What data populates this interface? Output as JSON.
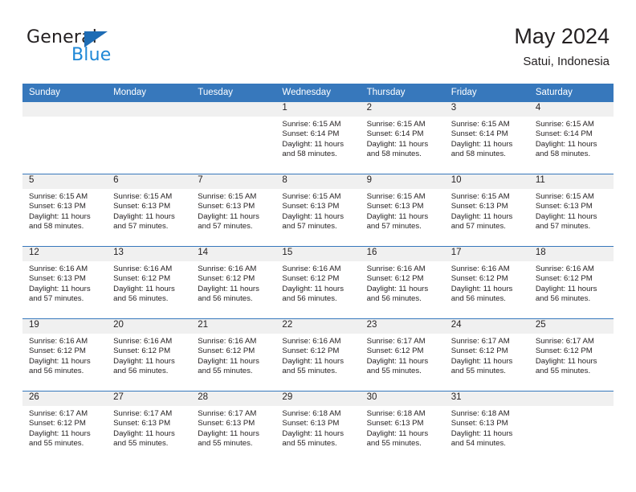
{
  "brand": {
    "name_top": "General",
    "name_bottom": "Blue",
    "accent_blue": "#1e87d6",
    "triangle_blue": "#1e6cb4"
  },
  "header": {
    "title": "May 2024",
    "subtitle": "Satui, Indonesia"
  },
  "theme": {
    "header_row_bg": "#3778bc",
    "daynum_band_bg": "#f0f0f0",
    "text_color": "#231f20"
  },
  "weekday_headers": [
    "Sunday",
    "Monday",
    "Tuesday",
    "Wednesday",
    "Thursday",
    "Friday",
    "Saturday"
  ],
  "weeks": [
    [
      {
        "day": "",
        "blank": true,
        "sunrise": "",
        "sunset": "",
        "daylight_line1": "",
        "daylight_line2": ""
      },
      {
        "day": "",
        "blank": true,
        "sunrise": "",
        "sunset": "",
        "daylight_line1": "",
        "daylight_line2": ""
      },
      {
        "day": "",
        "blank": true,
        "sunrise": "",
        "sunset": "",
        "daylight_line1": "",
        "daylight_line2": ""
      },
      {
        "day": "1",
        "blank": false,
        "sunrise": "Sunrise: 6:15 AM",
        "sunset": "Sunset: 6:14 PM",
        "daylight_line1": "Daylight: 11 hours",
        "daylight_line2": "and 58 minutes."
      },
      {
        "day": "2",
        "blank": false,
        "sunrise": "Sunrise: 6:15 AM",
        "sunset": "Sunset: 6:14 PM",
        "daylight_line1": "Daylight: 11 hours",
        "daylight_line2": "and 58 minutes."
      },
      {
        "day": "3",
        "blank": false,
        "sunrise": "Sunrise: 6:15 AM",
        "sunset": "Sunset: 6:14 PM",
        "daylight_line1": "Daylight: 11 hours",
        "daylight_line2": "and 58 minutes."
      },
      {
        "day": "4",
        "blank": false,
        "sunrise": "Sunrise: 6:15 AM",
        "sunset": "Sunset: 6:14 PM",
        "daylight_line1": "Daylight: 11 hours",
        "daylight_line2": "and 58 minutes."
      }
    ],
    [
      {
        "day": "5",
        "blank": false,
        "sunrise": "Sunrise: 6:15 AM",
        "sunset": "Sunset: 6:13 PM",
        "daylight_line1": "Daylight: 11 hours",
        "daylight_line2": "and 58 minutes."
      },
      {
        "day": "6",
        "blank": false,
        "sunrise": "Sunrise: 6:15 AM",
        "sunset": "Sunset: 6:13 PM",
        "daylight_line1": "Daylight: 11 hours",
        "daylight_line2": "and 57 minutes."
      },
      {
        "day": "7",
        "blank": false,
        "sunrise": "Sunrise: 6:15 AM",
        "sunset": "Sunset: 6:13 PM",
        "daylight_line1": "Daylight: 11 hours",
        "daylight_line2": "and 57 minutes."
      },
      {
        "day": "8",
        "blank": false,
        "sunrise": "Sunrise: 6:15 AM",
        "sunset": "Sunset: 6:13 PM",
        "daylight_line1": "Daylight: 11 hours",
        "daylight_line2": "and 57 minutes."
      },
      {
        "day": "9",
        "blank": false,
        "sunrise": "Sunrise: 6:15 AM",
        "sunset": "Sunset: 6:13 PM",
        "daylight_line1": "Daylight: 11 hours",
        "daylight_line2": "and 57 minutes."
      },
      {
        "day": "10",
        "blank": false,
        "sunrise": "Sunrise: 6:15 AM",
        "sunset": "Sunset: 6:13 PM",
        "daylight_line1": "Daylight: 11 hours",
        "daylight_line2": "and 57 minutes."
      },
      {
        "day": "11",
        "blank": false,
        "sunrise": "Sunrise: 6:15 AM",
        "sunset": "Sunset: 6:13 PM",
        "daylight_line1": "Daylight: 11 hours",
        "daylight_line2": "and 57 minutes."
      }
    ],
    [
      {
        "day": "12",
        "blank": false,
        "sunrise": "Sunrise: 6:16 AM",
        "sunset": "Sunset: 6:13 PM",
        "daylight_line1": "Daylight: 11 hours",
        "daylight_line2": "and 57 minutes."
      },
      {
        "day": "13",
        "blank": false,
        "sunrise": "Sunrise: 6:16 AM",
        "sunset": "Sunset: 6:12 PM",
        "daylight_line1": "Daylight: 11 hours",
        "daylight_line2": "and 56 minutes."
      },
      {
        "day": "14",
        "blank": false,
        "sunrise": "Sunrise: 6:16 AM",
        "sunset": "Sunset: 6:12 PM",
        "daylight_line1": "Daylight: 11 hours",
        "daylight_line2": "and 56 minutes."
      },
      {
        "day": "15",
        "blank": false,
        "sunrise": "Sunrise: 6:16 AM",
        "sunset": "Sunset: 6:12 PM",
        "daylight_line1": "Daylight: 11 hours",
        "daylight_line2": "and 56 minutes."
      },
      {
        "day": "16",
        "blank": false,
        "sunrise": "Sunrise: 6:16 AM",
        "sunset": "Sunset: 6:12 PM",
        "daylight_line1": "Daylight: 11 hours",
        "daylight_line2": "and 56 minutes."
      },
      {
        "day": "17",
        "blank": false,
        "sunrise": "Sunrise: 6:16 AM",
        "sunset": "Sunset: 6:12 PM",
        "daylight_line1": "Daylight: 11 hours",
        "daylight_line2": "and 56 minutes."
      },
      {
        "day": "18",
        "blank": false,
        "sunrise": "Sunrise: 6:16 AM",
        "sunset": "Sunset: 6:12 PM",
        "daylight_line1": "Daylight: 11 hours",
        "daylight_line2": "and 56 minutes."
      }
    ],
    [
      {
        "day": "19",
        "blank": false,
        "sunrise": "Sunrise: 6:16 AM",
        "sunset": "Sunset: 6:12 PM",
        "daylight_line1": "Daylight: 11 hours",
        "daylight_line2": "and 56 minutes."
      },
      {
        "day": "20",
        "blank": false,
        "sunrise": "Sunrise: 6:16 AM",
        "sunset": "Sunset: 6:12 PM",
        "daylight_line1": "Daylight: 11 hours",
        "daylight_line2": "and 56 minutes."
      },
      {
        "day": "21",
        "blank": false,
        "sunrise": "Sunrise: 6:16 AM",
        "sunset": "Sunset: 6:12 PM",
        "daylight_line1": "Daylight: 11 hours",
        "daylight_line2": "and 55 minutes."
      },
      {
        "day": "22",
        "blank": false,
        "sunrise": "Sunrise: 6:16 AM",
        "sunset": "Sunset: 6:12 PM",
        "daylight_line1": "Daylight: 11 hours",
        "daylight_line2": "and 55 minutes."
      },
      {
        "day": "23",
        "blank": false,
        "sunrise": "Sunrise: 6:17 AM",
        "sunset": "Sunset: 6:12 PM",
        "daylight_line1": "Daylight: 11 hours",
        "daylight_line2": "and 55 minutes."
      },
      {
        "day": "24",
        "blank": false,
        "sunrise": "Sunrise: 6:17 AM",
        "sunset": "Sunset: 6:12 PM",
        "daylight_line1": "Daylight: 11 hours",
        "daylight_line2": "and 55 minutes."
      },
      {
        "day": "25",
        "blank": false,
        "sunrise": "Sunrise: 6:17 AM",
        "sunset": "Sunset: 6:12 PM",
        "daylight_line1": "Daylight: 11 hours",
        "daylight_line2": "and 55 minutes."
      }
    ],
    [
      {
        "day": "26",
        "blank": false,
        "sunrise": "Sunrise: 6:17 AM",
        "sunset": "Sunset: 6:12 PM",
        "daylight_line1": "Daylight: 11 hours",
        "daylight_line2": "and 55 minutes."
      },
      {
        "day": "27",
        "blank": false,
        "sunrise": "Sunrise: 6:17 AM",
        "sunset": "Sunset: 6:13 PM",
        "daylight_line1": "Daylight: 11 hours",
        "daylight_line2": "and 55 minutes."
      },
      {
        "day": "28",
        "blank": false,
        "sunrise": "Sunrise: 6:17 AM",
        "sunset": "Sunset: 6:13 PM",
        "daylight_line1": "Daylight: 11 hours",
        "daylight_line2": "and 55 minutes."
      },
      {
        "day": "29",
        "blank": false,
        "sunrise": "Sunrise: 6:18 AM",
        "sunset": "Sunset: 6:13 PM",
        "daylight_line1": "Daylight: 11 hours",
        "daylight_line2": "and 55 minutes."
      },
      {
        "day": "30",
        "blank": false,
        "sunrise": "Sunrise: 6:18 AM",
        "sunset": "Sunset: 6:13 PM",
        "daylight_line1": "Daylight: 11 hours",
        "daylight_line2": "and 55 minutes."
      },
      {
        "day": "31",
        "blank": false,
        "sunrise": "Sunrise: 6:18 AM",
        "sunset": "Sunset: 6:13 PM",
        "daylight_line1": "Daylight: 11 hours",
        "daylight_line2": "and 54 minutes."
      },
      {
        "day": "",
        "blank": true,
        "sunrise": "",
        "sunset": "",
        "daylight_line1": "",
        "daylight_line2": ""
      }
    ]
  ]
}
